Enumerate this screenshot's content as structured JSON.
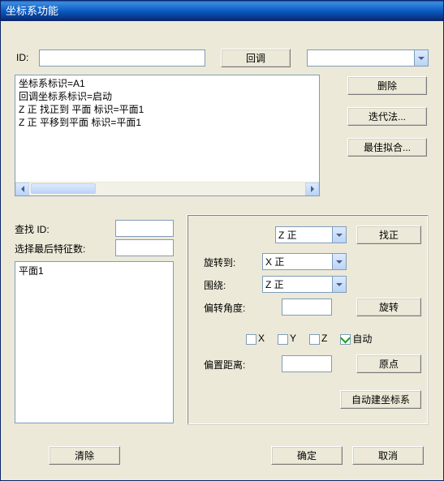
{
  "window": {
    "title": "坐标系功能"
  },
  "header": {
    "id_label": "ID:",
    "id_value": "",
    "recall_btn": "回调",
    "combo_value": ""
  },
  "log": {
    "lines": [
      "坐标系标识=A1",
      "回调坐标系标识=启动",
      "Z 正 找正到 平面 标识=平面1",
      "Z 正 平移到平面 标识=平面1"
    ]
  },
  "sidebar": {
    "delete_btn": "删除",
    "iterate_btn": "迭代法...",
    "bestfit_btn": "最佳拟合..."
  },
  "search": {
    "find_id_label": "查找 ID:",
    "find_id_value": "",
    "select_last_label": "选择最后特征数:",
    "select_last_value": ""
  },
  "features": {
    "items": [
      "平面1"
    ]
  },
  "axes": {
    "axis1_value": "Z 正",
    "find_btn": "找正",
    "rotate_to_label": "旋转到:",
    "rotate_to_value": "X 正",
    "around_label": "围绕:",
    "around_value": "Z 正",
    "offset_angle_label": "偏转角度:",
    "offset_angle_value": "",
    "rotate_btn": "旋转",
    "chk_x": "X",
    "chk_y": "Y",
    "chk_z": "Z",
    "chk_auto_label": "自动",
    "chk_auto_checked": true,
    "offset_dist_label": "偏置距离:",
    "offset_dist_value": "",
    "origin_btn": "原点",
    "autobuild_btn": "自动建坐标系"
  },
  "footer": {
    "clear_btn": "清除",
    "ok_btn": "确定",
    "cancel_btn": "取消"
  }
}
